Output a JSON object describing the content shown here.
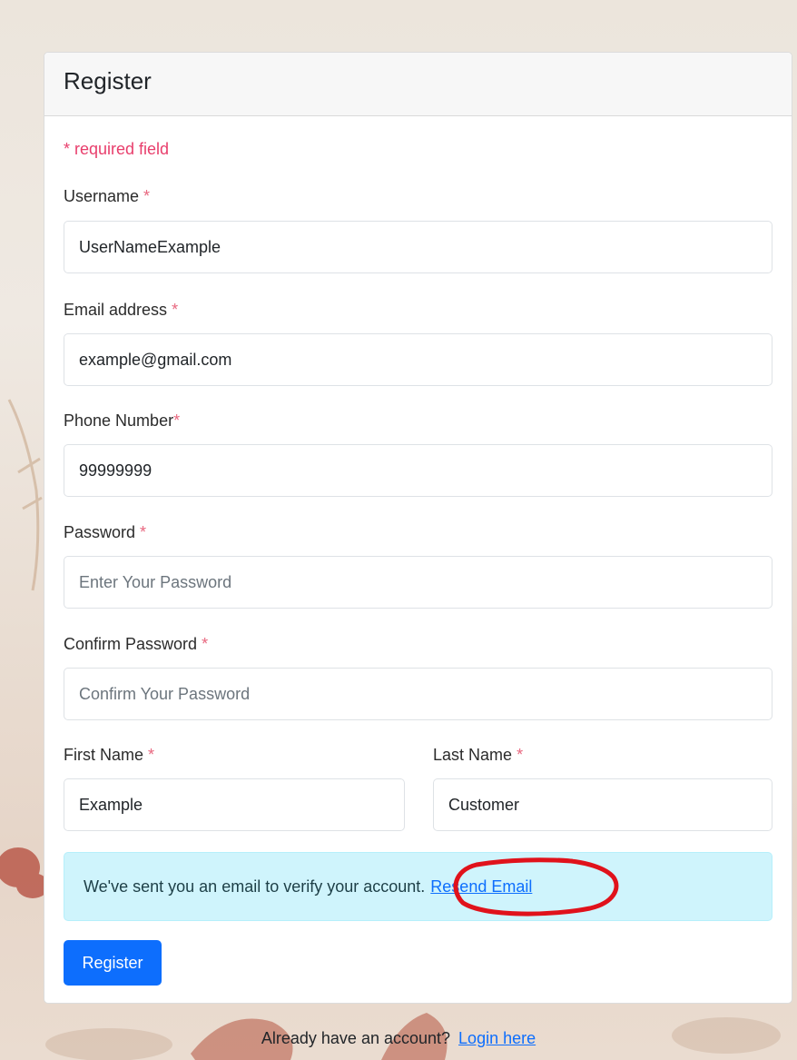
{
  "form": {
    "title": "Register",
    "required_note": "* required field",
    "required_mark": "*",
    "fields": {
      "username": {
        "label": "Username",
        "value": "UserNameExample"
      },
      "email": {
        "label": "Email address",
        "value": "example@gmail.com"
      },
      "phone": {
        "label": "Phone Number",
        "value": "99999999"
      },
      "password": {
        "label": "Password",
        "value": "",
        "placeholder": "Enter Your Password"
      },
      "confirm_password": {
        "label": "Confirm Password",
        "value": "",
        "placeholder": "Confirm Your Password"
      },
      "first_name": {
        "label": "First Name",
        "value": "Example"
      },
      "last_name": {
        "label": "Last Name",
        "value": "Customer"
      }
    },
    "alert": {
      "message": "We've sent you an email to verify your account.",
      "link_label": "Resend Email"
    },
    "submit_label": "Register"
  },
  "footer": {
    "text": "Already have an account?",
    "link_label": "Login here"
  },
  "colors": {
    "primary": "#0d6efd",
    "required": "#e83e6c",
    "alert_bg": "#cff4fc",
    "annotation": "#e0121b"
  }
}
